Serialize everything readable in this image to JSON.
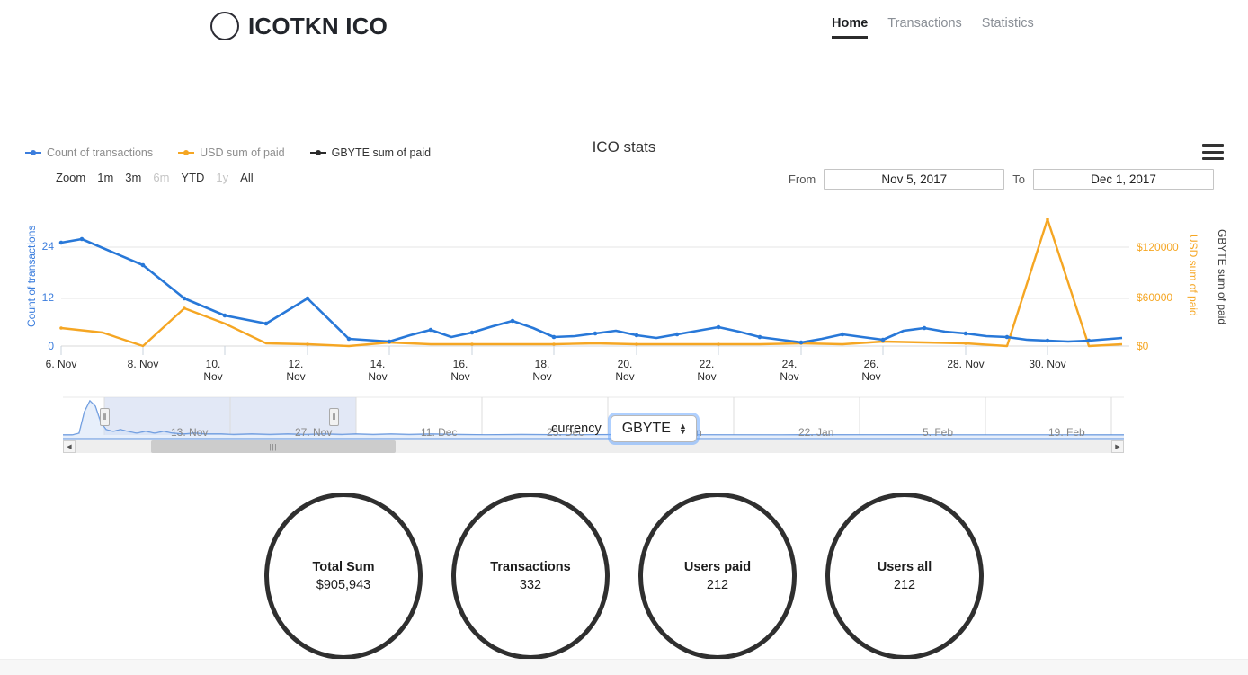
{
  "header": {
    "logo_icon": "circle-outline-icon",
    "brand": "ICOTKN ICO",
    "nav": [
      {
        "label": "Home",
        "active": true
      },
      {
        "label": "Transactions",
        "active": false
      },
      {
        "label": "Statistics",
        "active": false
      }
    ]
  },
  "chart": {
    "title": "ICO stats",
    "menu_icon": "hamburger-menu-icon",
    "legend": [
      {
        "label": "Count of transactions",
        "color": "#3b7ddd"
      },
      {
        "label": "USD sum of paid",
        "color": "#f5a623"
      },
      {
        "label": "GBYTE sum of paid",
        "color": "#2b2b2b"
      }
    ],
    "zoom": {
      "label": "Zoom",
      "buttons": [
        {
          "label": "1m",
          "disabled": false
        },
        {
          "label": "3m",
          "disabled": false
        },
        {
          "label": "6m",
          "disabled": true
        },
        {
          "label": "YTD",
          "disabled": false
        },
        {
          "label": "1y",
          "disabled": true
        },
        {
          "label": "All",
          "disabled": false
        }
      ]
    },
    "range": {
      "from_label": "From",
      "from_value": "Nov 5, 2017",
      "to_label": "To",
      "to_value": "Dec 1, 2017"
    },
    "navigator": {
      "labels": [
        "13. Nov",
        "27. Nov",
        "11. Dec",
        "25. Dec",
        "8. Jan",
        "22. Jan",
        "5. Feb",
        "19. Feb"
      ],
      "left_handle_icon": "drag-handle-icon",
      "right_handle_icon": "drag-handle-icon",
      "scroll_left_icon": "arrow-left-icon",
      "scroll_right_icon": "arrow-right-icon",
      "thumb_grip_icon": "grip-icon"
    }
  },
  "chart_data": {
    "type": "line",
    "title": "ICO stats",
    "xlabel": "",
    "ylabel": "Count of transactions",
    "grid": true,
    "legend_position": "top-left",
    "x": [
      "5. Nov",
      "6. Nov",
      "7. Nov",
      "8. Nov",
      "9. Nov",
      "10. Nov",
      "11. Nov",
      "12. Nov",
      "13. Nov",
      "14. Nov",
      "15. Nov",
      "16. Nov",
      "17. Nov",
      "18. Nov",
      "19. Nov",
      "20. Nov",
      "21. Nov",
      "22. Nov",
      "23. Nov",
      "24. Nov",
      "25. Nov",
      "26. Nov",
      "27. Nov",
      "28. Nov",
      "29. Nov",
      "30. Nov",
      "1. Dec"
    ],
    "axes": {
      "left": {
        "label": "Count of transactions",
        "ticks": [
          0,
          12,
          24
        ],
        "ylim": [
          0,
          30
        ],
        "color": "#3b7ddd"
      },
      "right_usd": {
        "label": "USD sum of paid",
        "ticks": [
          "$0",
          "$60000",
          "$120000"
        ],
        "ylim": [
          0,
          180000
        ],
        "color": "#f5a623"
      },
      "right_gbyte": {
        "label": "GBYTE sum of paid",
        "color": "#2b2b2b"
      }
    },
    "xtick_labels": [
      "6. Nov",
      "8. Nov",
      "10. Nov",
      "12. Nov",
      "14. Nov",
      "16. Nov",
      "18. Nov",
      "20. Nov",
      "22. Nov",
      "24. Nov",
      "26. Nov",
      "28. Nov",
      "30. Nov"
    ],
    "series": [
      {
        "name": "Count of transactions",
        "color": "#3b7ddd",
        "axis": "left",
        "values": [
          26,
          27,
          19,
          21,
          15,
          12,
          8,
          12,
          3,
          1,
          5,
          2,
          4,
          6,
          2,
          1,
          3,
          1,
          2,
          4,
          7,
          1,
          3,
          4,
          4,
          1,
          2
        ]
      },
      {
        "name": "USD sum of paid",
        "color": "#f5a623",
        "axis": "right_usd",
        "values": [
          22000,
          18000,
          4000,
          60000,
          32000,
          6000,
          5000,
          55000,
          5000,
          1000,
          1500,
          1000,
          1000,
          1200,
          800,
          600,
          900,
          1000,
          2000,
          1200,
          2000,
          1500,
          1000,
          1500,
          500,
          162000,
          1000
        ]
      },
      {
        "name": "GBYTE sum of paid",
        "color": "#2b2b2b",
        "axis": "right_gbyte",
        "values": []
      }
    ]
  },
  "currency": {
    "label": "currency",
    "value": "GBYTE",
    "stepper_icon": "stepper-arrows-icon"
  },
  "stats": [
    {
      "title": "Total Sum",
      "value": "$905,943"
    },
    {
      "title": "Transactions",
      "value": "332"
    },
    {
      "title": "Users paid",
      "value": "212"
    },
    {
      "title": "Users all",
      "value": "212"
    }
  ]
}
